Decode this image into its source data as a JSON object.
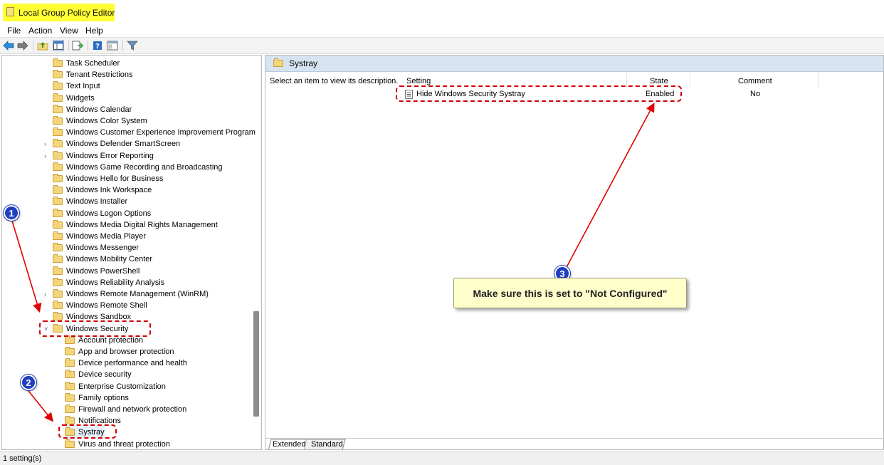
{
  "window": {
    "title": "Local Group Policy Editor"
  },
  "menu": [
    "File",
    "Action",
    "View",
    "Help"
  ],
  "toolbar": {
    "icons": [
      "back-arrow-icon",
      "forward-arrow-icon",
      "up-folder-icon",
      "show-hide-tree-icon",
      "export-list-icon",
      "help-icon",
      "properties-icon",
      "filter-icon"
    ]
  },
  "tree": {
    "items": [
      {
        "label": "Task Scheduler",
        "expandable": false
      },
      {
        "label": "Tenant Restrictions",
        "expandable": false
      },
      {
        "label": "Text Input",
        "expandable": false
      },
      {
        "label": "Widgets",
        "expandable": false
      },
      {
        "label": "Windows Calendar",
        "expandable": false
      },
      {
        "label": "Windows Color System",
        "expandable": false
      },
      {
        "label": "Windows Customer Experience Improvement Program",
        "expandable": false
      },
      {
        "label": "Windows Defender SmartScreen",
        "expandable": true
      },
      {
        "label": "Windows Error Reporting",
        "expandable": true
      },
      {
        "label": "Windows Game Recording and Broadcasting",
        "expandable": false
      },
      {
        "label": "Windows Hello for Business",
        "expandable": false
      },
      {
        "label": "Windows Ink Workspace",
        "expandable": false
      },
      {
        "label": "Windows Installer",
        "expandable": false
      },
      {
        "label": "Windows Logon Options",
        "expandable": false
      },
      {
        "label": "Windows Media Digital Rights Management",
        "expandable": false
      },
      {
        "label": "Windows Media Player",
        "expandable": false
      },
      {
        "label": "Windows Messenger",
        "expandable": false
      },
      {
        "label": "Windows Mobility Center",
        "expandable": false
      },
      {
        "label": "Windows PowerShell",
        "expandable": false
      },
      {
        "label": "Windows Reliability Analysis",
        "expandable": false
      },
      {
        "label": "Windows Remote Management (WinRM)",
        "expandable": true
      },
      {
        "label": "Windows Remote Shell",
        "expandable": false
      },
      {
        "label": "Windows Sandbox",
        "expandable": false
      },
      {
        "label": "Windows Security",
        "expandable": true,
        "expanded": true
      }
    ],
    "children": [
      {
        "label": "Account protection"
      },
      {
        "label": "App and browser protection"
      },
      {
        "label": "Device performance and health"
      },
      {
        "label": "Device security"
      },
      {
        "label": "Enterprise Customization"
      },
      {
        "label": "Family options"
      },
      {
        "label": "Firewall and network protection"
      },
      {
        "label": "Notifications"
      },
      {
        "label": "Systray",
        "selected": true
      },
      {
        "label": "Virus and threat protection"
      }
    ]
  },
  "details": {
    "header_title": "Systray",
    "description": "Select an item to view its description.",
    "columns": [
      "Setting",
      "State",
      "Comment"
    ],
    "rows": [
      {
        "setting": "Hide Windows Security Systray",
        "state": "Enabled",
        "comment": "No"
      }
    ],
    "tabs": [
      "Extended",
      "Standard"
    ]
  },
  "status": {
    "text": "1 setting(s)"
  },
  "annotations": {
    "note": "Make sure this is set to \"Not Configured\"",
    "badges": [
      "1",
      "2",
      "3"
    ],
    "accent": "#d00000",
    "badge_color": "#1f3fbf",
    "note_bg": "#ffffcc"
  }
}
